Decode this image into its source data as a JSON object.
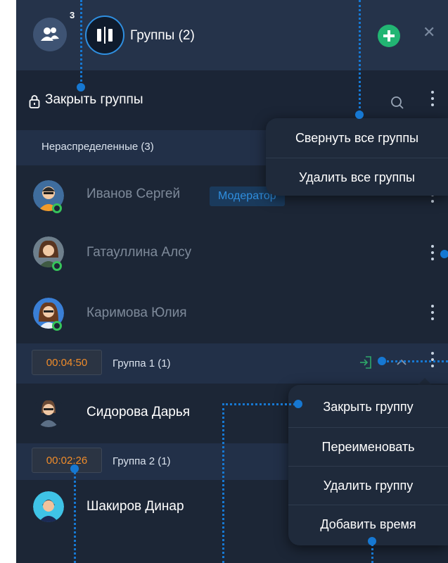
{
  "header": {
    "participants_badge": "3",
    "title": "Группы (2)",
    "participants_icon": "people-icon",
    "groups_icon": "split-view-icon",
    "add_icon": "plus-icon",
    "close_icon": "close-icon"
  },
  "toolbar": {
    "lock_label": "Закрыть группы",
    "lock_icon": "lock-icon",
    "search_icon": "search-icon"
  },
  "unassigned": {
    "label": "Нераспределенные (3)",
    "members": [
      {
        "name": "Иванов Сергей",
        "role": "Модератор",
        "online": true
      },
      {
        "name": "Гатауллина Алсу",
        "online": true
      },
      {
        "name": "Каримова Юлия",
        "online": true
      }
    ]
  },
  "groups": [
    {
      "timer": "00:04:50",
      "label": "Группа 1 (1)",
      "members": [
        {
          "name": "Сидорова Дарья"
        }
      ]
    },
    {
      "timer": "00:02:26",
      "label": "Группа 2 (1)",
      "members": [
        {
          "name": "Шакиров Динар"
        }
      ]
    }
  ],
  "top_menu": {
    "items": [
      "Свернуть все группы",
      "Удалить все группы"
    ]
  },
  "group_menu": {
    "items": [
      "Закрыть группу",
      "Переименовать",
      "Удалить группу",
      "Добавить время"
    ]
  },
  "colors": {
    "panel": "#1c2636",
    "header": "#25334a",
    "accent": "#2f8fe0",
    "timer": "#f08c2a",
    "online": "#36c35a",
    "add": "#22b573",
    "annotation": "#1678d2"
  }
}
